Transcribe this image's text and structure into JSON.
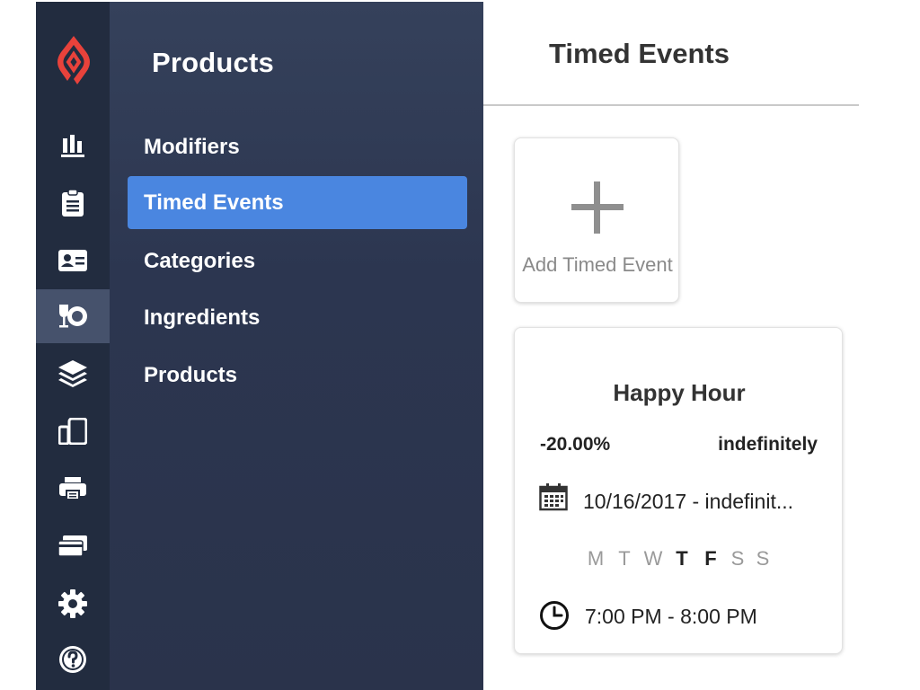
{
  "rail": {
    "items": [
      {
        "icon": "reports-icon"
      },
      {
        "icon": "orders-clipboard-icon"
      },
      {
        "icon": "customers-card-icon"
      },
      {
        "icon": "products-dish-icon",
        "active": true
      },
      {
        "icon": "layers-icon"
      },
      {
        "icon": "devices-icon"
      },
      {
        "icon": "printer-icon"
      },
      {
        "icon": "payments-card-icon"
      },
      {
        "icon": "settings-gear-icon"
      },
      {
        "icon": "help-icon"
      }
    ],
    "accent": "#e8423b"
  },
  "subnav": {
    "title": "Products",
    "items": [
      {
        "label": "Modifiers"
      },
      {
        "label": "Timed Events",
        "selected": true
      },
      {
        "label": "Categories"
      },
      {
        "label": "Ingredients"
      },
      {
        "label": "Products"
      }
    ],
    "selected_color": "#4a86e0"
  },
  "main": {
    "title": "Timed Events",
    "add_card": {
      "label": "Add Timed Event"
    },
    "event": {
      "name": "Happy Hour",
      "discount": "-20.00%",
      "duration": "indefinitely",
      "dates": "10/16/2017 - indefinit...",
      "days": [
        {
          "label": "M",
          "active": false
        },
        {
          "label": "T",
          "active": false
        },
        {
          "label": "W",
          "active": false
        },
        {
          "label": "T",
          "active": true
        },
        {
          "label": "F",
          "active": true
        },
        {
          "label": "S",
          "active": false
        },
        {
          "label": "S",
          "active": false
        }
      ],
      "time": "7:00 PM - 8:00 PM"
    }
  }
}
